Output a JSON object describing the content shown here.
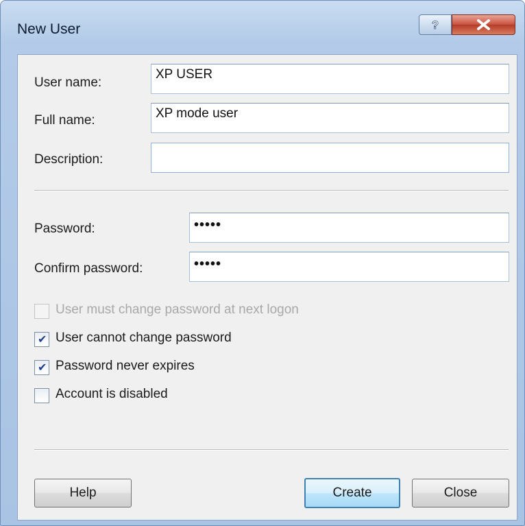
{
  "window": {
    "title": "New User"
  },
  "titlebar_buttons": {
    "help_icon": "question-icon",
    "close_icon": "close-icon"
  },
  "form": {
    "username": {
      "label": "User name:",
      "value": "XP USER"
    },
    "fullname": {
      "label": "Full name:",
      "value": "XP mode user"
    },
    "description": {
      "label": "Description:",
      "value": ""
    },
    "password": {
      "label": "Password:",
      "value": "•••••"
    },
    "confirm_password": {
      "label": "Confirm password:",
      "value": "•••••"
    }
  },
  "options": [
    {
      "label": "User must change password at next logon",
      "checked": false,
      "enabled": false
    },
    {
      "label": "User cannot change password",
      "checked": true,
      "enabled": true
    },
    {
      "label": "Password never expires",
      "checked": true,
      "enabled": true
    },
    {
      "label": "Account is disabled",
      "checked": false,
      "enabled": true
    }
  ],
  "buttons": {
    "help": "Help",
    "create": "Create",
    "close": "Close"
  },
  "colors": {
    "default_button_border": "#3c7fb1",
    "close_button": "#c9513f"
  }
}
